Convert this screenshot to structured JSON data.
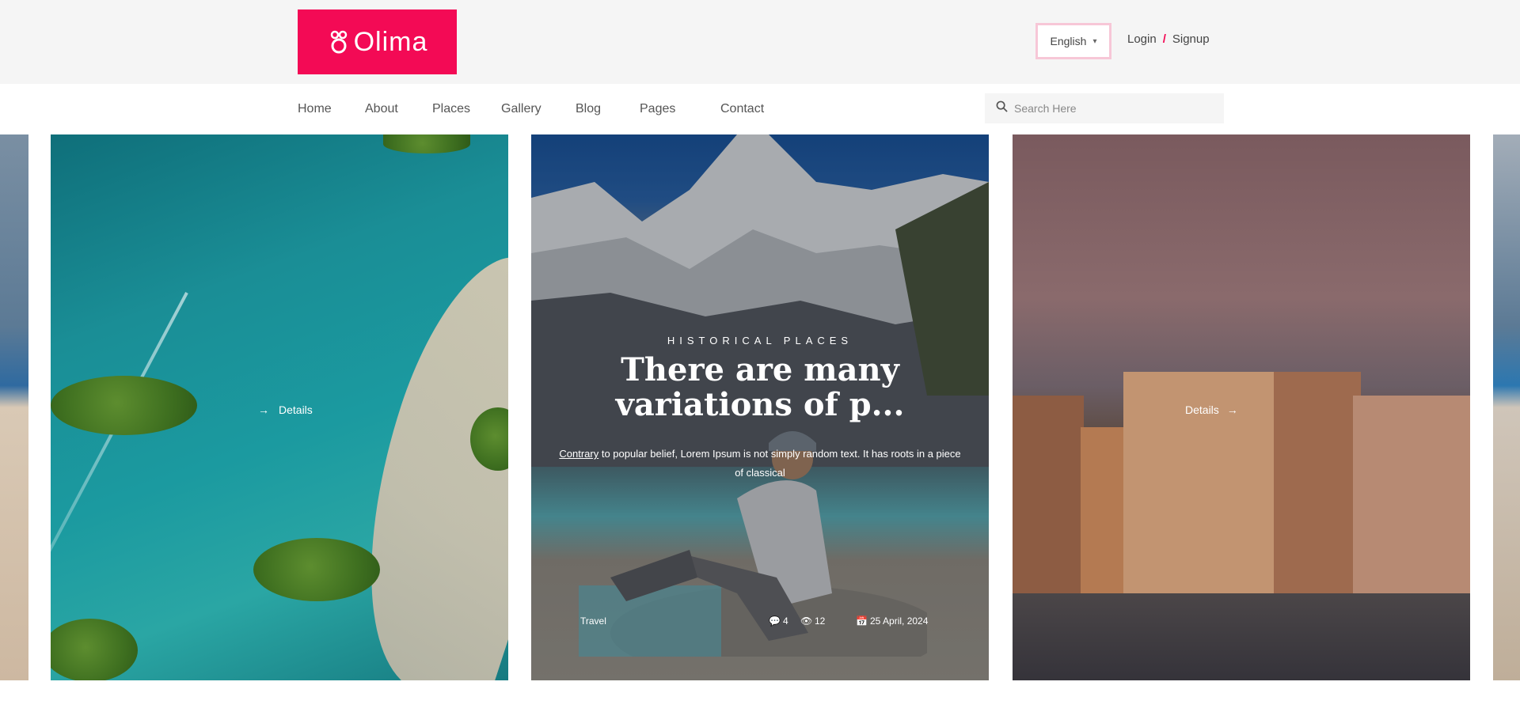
{
  "header": {
    "logo_text": "Olima",
    "language": "English",
    "login_label": "Login",
    "separator": "/",
    "signup_label": "Signup",
    "brand_color": "#f30a55"
  },
  "nav": {
    "items": [
      "Home",
      "About",
      "Places",
      "Gallery",
      "Blog",
      "Pages",
      "Contact"
    ]
  },
  "search": {
    "placeholder": "Search Here"
  },
  "slides": {
    "left": {
      "label": "Details"
    },
    "featured": {
      "category": "HISTORICAL PLACES",
      "title": "There are many variations of p...",
      "excerpt_link": "Contrary",
      "excerpt": "to popular belief, Lorem Ipsum is not simply random text. It has roots in a piece of classical",
      "meta_category": "Travel",
      "meta_comments": "4",
      "meta_views": "12",
      "meta_date": "25 April, 2024"
    },
    "right": {
      "label": "Details"
    }
  },
  "icons": {
    "logo": "flower-icon",
    "search": "search-icon",
    "caret": "chevron-down-icon",
    "arrow": "arrow-right-icon"
  }
}
